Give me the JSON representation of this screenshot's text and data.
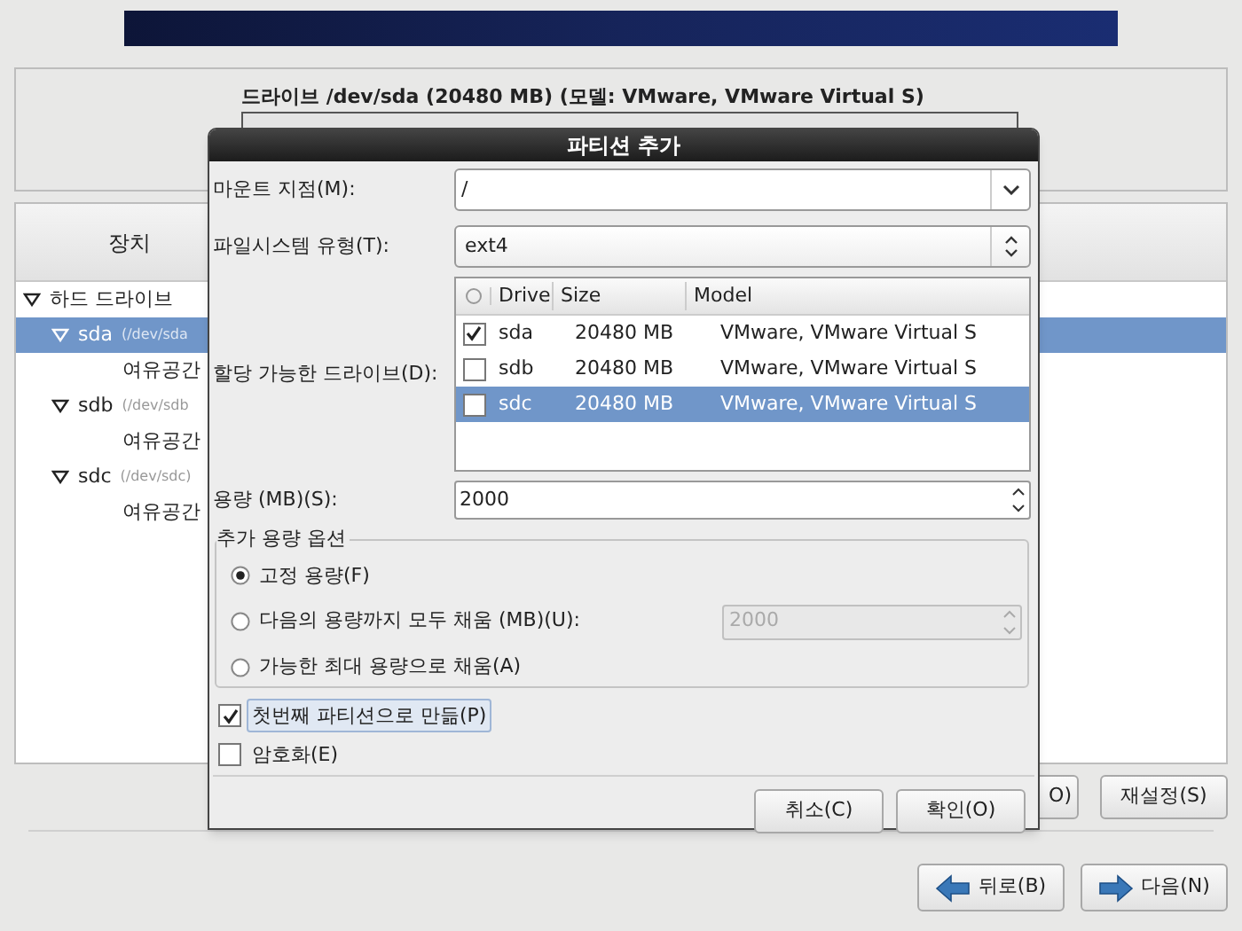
{
  "drive_panel": {
    "title": "드라이브 /dev/sda (20480 MB) (모델: VMware, VMware Virtual S)"
  },
  "device_panel": {
    "column_header": "장치",
    "tree": [
      {
        "label": "하드 드라이브",
        "expanded": true,
        "selected": false,
        "children": [
          {
            "label": "sda",
            "path": "(/dev/sda",
            "expanded": true,
            "selected": true,
            "children": [
              {
                "label": "여유공간",
                "selected": false
              }
            ]
          },
          {
            "label": "sdb",
            "path": "(/dev/sdb",
            "expanded": true,
            "selected": false,
            "children": [
              {
                "label": "여유공간",
                "selected": false
              }
            ]
          },
          {
            "label": "sdc",
            "path": "(/dev/sdc)",
            "expanded": true,
            "selected": false,
            "children": [
              {
                "label": "여유공간",
                "selected": false
              }
            ]
          }
        ]
      }
    ],
    "buttons": [
      "O)",
      "재설정(S)"
    ]
  },
  "nav_buttons": [
    {
      "label": "뒤로(B)",
      "kind": "back"
    },
    {
      "label": "다음(N)",
      "kind": "next"
    }
  ],
  "dialog": {
    "title": "파티션 추가",
    "mount_point": {
      "label": "마운트 지점(M):",
      "value": "/"
    },
    "fs_type": {
      "label": "파일시스템 유형(T):",
      "value": "ext4"
    },
    "drives": {
      "label": "할당 가능한 드라이브(D):",
      "columns": [
        "Drive",
        "Size",
        "Model"
      ],
      "rows": [
        {
          "drive": "sda",
          "size": "20480 MB",
          "model": "VMware, VMware Virtual S",
          "checked": true,
          "selected": false
        },
        {
          "drive": "sdb",
          "size": "20480 MB",
          "model": "VMware, VMware Virtual S",
          "checked": false,
          "selected": false
        },
        {
          "drive": "sdc",
          "size": "20480 MB",
          "model": "VMware, VMware Virtual S",
          "checked": false,
          "selected": true
        }
      ]
    },
    "size": {
      "label": "용량 (MB)(S):",
      "value": "2000"
    },
    "options": {
      "title": "추가 용량 옵션",
      "items": [
        {
          "label": "고정 용량(F)",
          "selected": true
        },
        {
          "label": "다음의 용량까지 모두 채움 (MB)(U):",
          "selected": false,
          "value": "2000",
          "disabled": true
        },
        {
          "label": "가능한 최대 용량으로 채움(A)",
          "selected": false
        }
      ]
    },
    "checkboxes": [
      {
        "label": "첫번째 파티션으로 만듦(P)",
        "checked": true,
        "focused": true
      },
      {
        "label": "암호화(E)",
        "checked": false,
        "focused": false
      }
    ],
    "buttons": [
      "취소(C)",
      "확인(O)"
    ]
  }
}
